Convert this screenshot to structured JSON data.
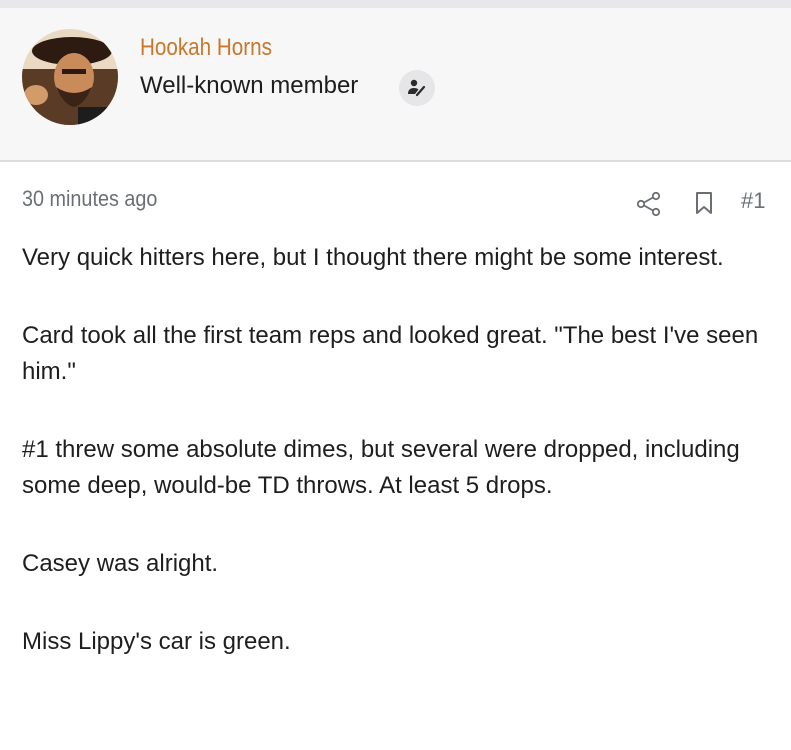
{
  "user": {
    "name": "Hookah Horns",
    "title": "Well-known member",
    "avatar_icon": "avatar-image",
    "badge_icon": "verified-member-icon"
  },
  "post": {
    "time": "30 minutes ago",
    "share_icon": "share-icon",
    "bookmark_icon": "bookmark-icon",
    "number": "#1",
    "paragraphs": [
      "Very quick hitters here, but I thought there might be some interest.",
      "Card took all the first team reps and looked great. \"The best I've seen him.\"",
      "#1 threw some absolute dimes, but several were dropped, including some deep, would-be TD throws. At least 5 drops.",
      "Casey was alright.",
      "Miss Lippy's car is green."
    ]
  },
  "colors": {
    "username": "#c9772a",
    "meta": "#6b6f75",
    "header_bg": "#f7f7f7",
    "text": "#1e1e1e"
  }
}
